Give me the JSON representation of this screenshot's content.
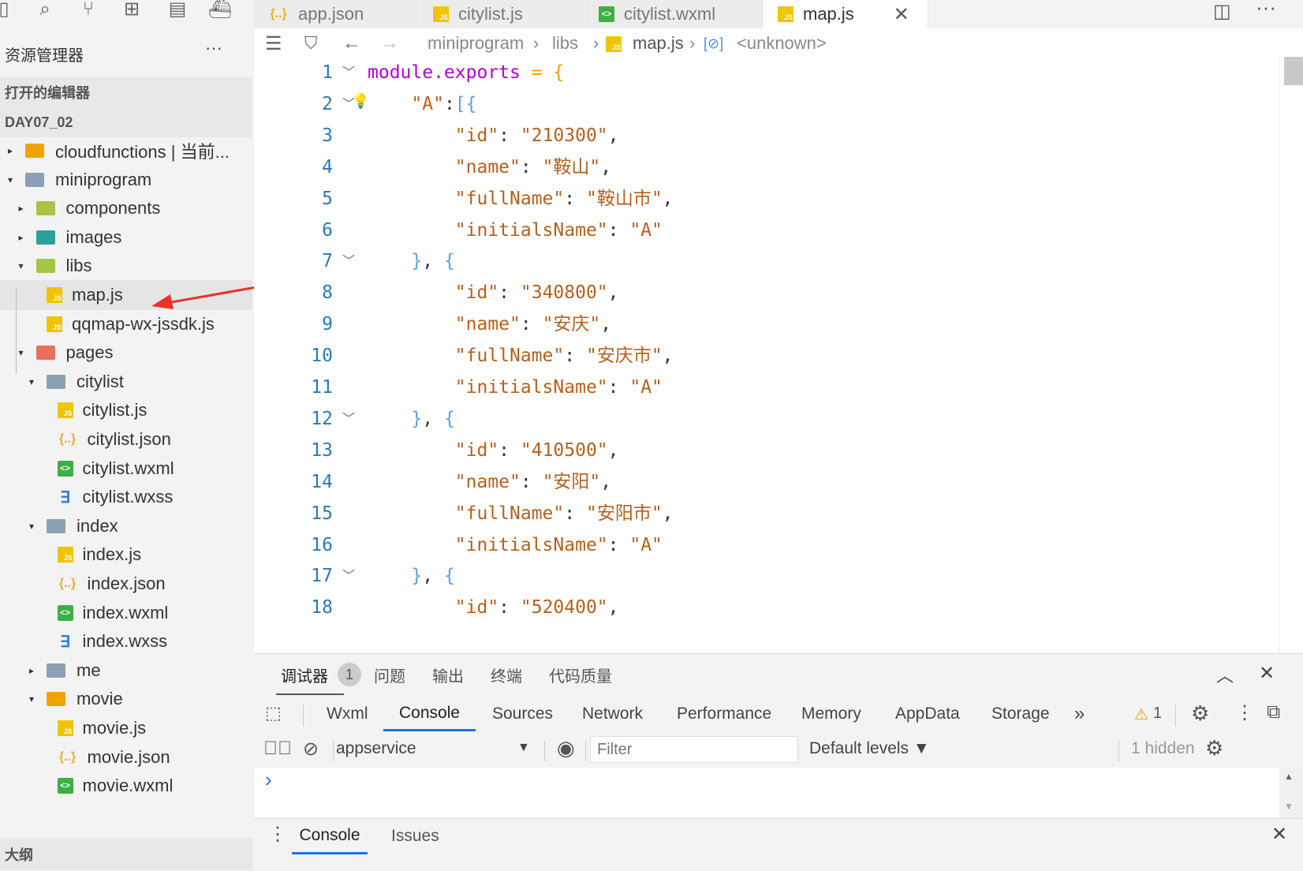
{
  "tabs": [
    {
      "label": "app.json",
      "icon": "json-icon"
    },
    {
      "label": "citylist.js",
      "icon": "js-icon"
    },
    {
      "label": "citylist.wxml",
      "icon": "wxml-icon"
    },
    {
      "label": "map.js",
      "icon": "js-icon",
      "active": true
    }
  ],
  "sidebar": {
    "title": "资源管理器",
    "more": "···",
    "open_editors": "打开的编辑器",
    "project": "DAY07_02",
    "outline": "大纲",
    "items": [
      {
        "label": "cloudfunctions | 当前...",
        "type": "folder",
        "color": "#f0a400"
      },
      {
        "label": "miniprogram",
        "type": "folder",
        "color": "#8aa0b4"
      },
      {
        "label": "components",
        "type": "folder",
        "color": "#a6c545"
      },
      {
        "label": "images",
        "type": "folder",
        "color": "#2aa198"
      },
      {
        "label": "libs",
        "type": "folder",
        "color": "#a6c545"
      },
      {
        "label": "map.js",
        "type": "js"
      },
      {
        "label": "qqmap-wx-jssdk.js",
        "type": "js"
      },
      {
        "label": "pages",
        "type": "folder",
        "color": "#e8705a"
      },
      {
        "label": "citylist",
        "type": "folder",
        "color": "#8aa0b4"
      },
      {
        "label": "citylist.js",
        "type": "js"
      },
      {
        "label": "citylist.json",
        "type": "json"
      },
      {
        "label": "citylist.wxml",
        "type": "wxml"
      },
      {
        "label": "citylist.wxss",
        "type": "wxss"
      },
      {
        "label": "index",
        "type": "folder",
        "color": "#8aa0b4"
      },
      {
        "label": "index.js",
        "type": "js"
      },
      {
        "label": "index.json",
        "type": "json"
      },
      {
        "label": "index.wxml",
        "type": "wxml"
      },
      {
        "label": "index.wxss",
        "type": "wxss"
      },
      {
        "label": "me",
        "type": "folder",
        "color": "#8aa0b4"
      },
      {
        "label": "movie",
        "type": "folder",
        "color": "#f0a400"
      },
      {
        "label": "movie.js",
        "type": "js"
      },
      {
        "label": "movie.json",
        "type": "json"
      },
      {
        "label": "movie.wxml",
        "type": "wxml"
      }
    ]
  },
  "breadcrumb": {
    "a": "miniprogram",
    "b": "libs",
    "c": "map.js",
    "d": "<unknown>"
  },
  "code": {
    "l1_kw": "module.exports",
    "l1_rest": " = {",
    "key_A": "\"A\"",
    "entries": [
      {
        "id": "\"210300\"",
        "name": "\"鞍山\"",
        "full": "\"鞍山市\"",
        "init": "\"A\""
      },
      {
        "id": "\"340800\"",
        "name": "\"安庆\"",
        "full": "\"安庆市\"",
        "init": "\"A\""
      },
      {
        "id": "\"410500\"",
        "name": "\"安阳\"",
        "full": "\"安阳市\"",
        "init": "\"A\""
      },
      {
        "id": "\"520400\""
      }
    ],
    "k_id": "\"id\"",
    "k_name": "\"name\"",
    "k_full": "\"fullName\"",
    "k_init": "\"initialsName\""
  },
  "panel": {
    "tabs": [
      "调试器",
      "问题",
      "输出",
      "终端",
      "代码质量"
    ],
    "badge": "1",
    "devtools_tabs": [
      "Wxml",
      "Console",
      "Sources",
      "Network",
      "Performance",
      "Memory",
      "AppData",
      "Storage"
    ],
    "warn_count": "1",
    "context": "appservice",
    "filter_placeholder": "Filter",
    "levels": "Default levels ▼",
    "hidden": "1 hidden",
    "prompt": "›",
    "drawer_tabs": [
      "Console",
      "Issues"
    ]
  }
}
